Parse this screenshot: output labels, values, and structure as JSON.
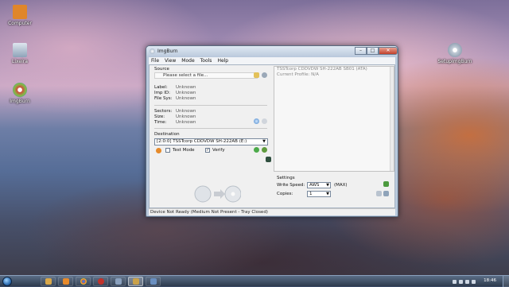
{
  "desktop": {
    "icons": [
      {
        "label": "Computer",
        "color": "#e0862a"
      },
      {
        "label": "Lixeira",
        "color": "#9fb5c9"
      },
      {
        "label": "ImgBurn",
        "color": "#d24a3a"
      },
      {
        "label": "SetupImgBurn",
        "color": "#c5cfd9"
      }
    ]
  },
  "window": {
    "title": "ImgBurn",
    "menu": [
      "File",
      "View",
      "Mode",
      "Tools",
      "Help"
    ],
    "close_glyph": "✕",
    "minimize_glyph": "–",
    "maximize_glyph": "□",
    "source": {
      "label": "Source",
      "placeholder": "Please select a file..."
    },
    "file_info": [
      {
        "label": "Label:",
        "value": "Unknown"
      },
      {
        "label": "Imp ID:",
        "value": "Unknown"
      },
      {
        "label": "File Sys:",
        "value": "Unknown"
      }
    ],
    "disc_info": [
      {
        "label": "Sectors:",
        "value": "Unknown"
      },
      {
        "label": "Size:",
        "value": "Unknown"
      },
      {
        "label": "Time:",
        "value": "Unknown"
      }
    ],
    "destination": {
      "label": "Destination",
      "selected": "[2:0:0] TSSTcorp CDDVDW SH-222AB (E:)"
    },
    "test_mode": {
      "label": "Test Mode",
      "checked": false
    },
    "verify": {
      "label": "Verify",
      "checked": true
    },
    "info_panel": [
      "TSSTcorp CDDVDW SH-222AB SB01 (ATA)",
      "Current Profile: N/A"
    ],
    "settings": {
      "title": "Settings",
      "write_speed_label": "Write Speed:",
      "write_speed_value": "AWS",
      "write_speed_extra": "(MAX)",
      "copies_label": "Copies:",
      "copies_value": "1"
    },
    "status": "Device Not Ready (Medium Not Present - Tray Closed)"
  },
  "taskbar": {
    "buttons": [
      {
        "name": "explorer",
        "color": "#d9a84a",
        "active": false
      },
      {
        "name": "media-player",
        "color": "#e78a2b",
        "active": false
      },
      {
        "name": "chrome",
        "color": "#4a9a3a",
        "active": false
      },
      {
        "name": "record",
        "color": "#c2322b",
        "active": false
      },
      {
        "name": "app",
        "color": "#8aa0bd",
        "active": false
      },
      {
        "name": "imgburn",
        "color": "#c9a14a",
        "active": true
      },
      {
        "name": "app2",
        "color": "#6a8fc0",
        "active": false
      }
    ],
    "clock": "18:46"
  }
}
